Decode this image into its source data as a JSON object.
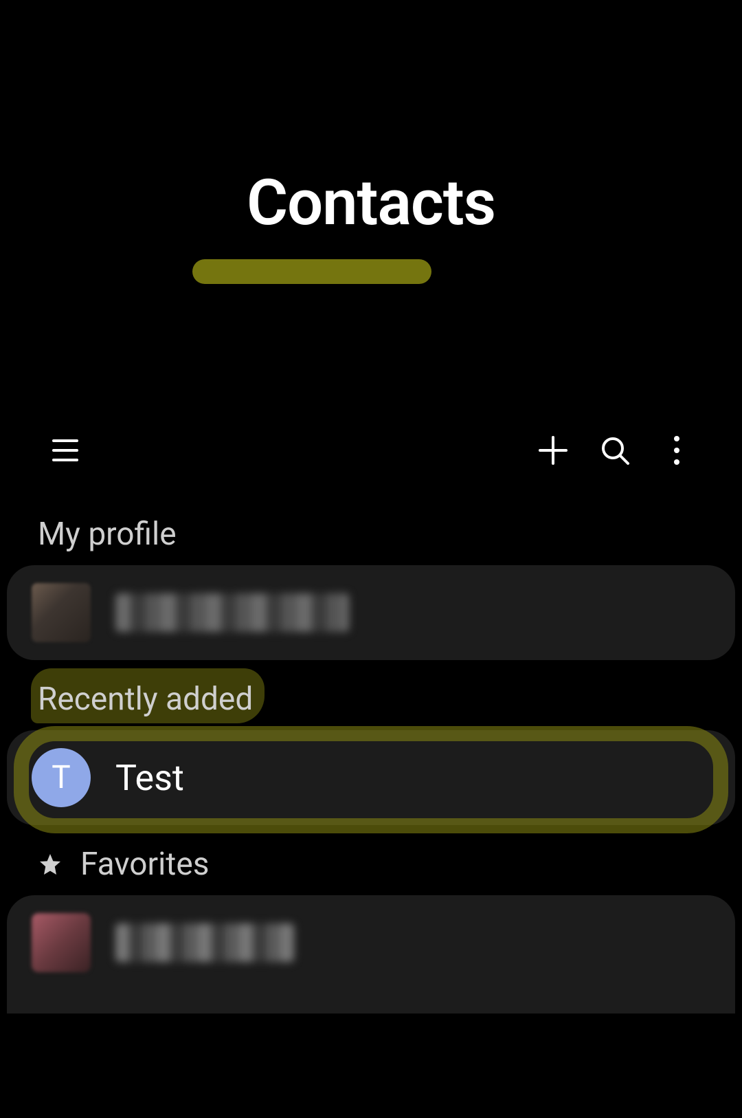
{
  "header": {
    "title": "Contacts"
  },
  "toolbar": {
    "menu_icon": "menu-icon",
    "add_icon": "plus-icon",
    "search_icon": "search-icon",
    "more_icon": "more-vertical-icon"
  },
  "sections": {
    "my_profile": {
      "label": "My profile",
      "items": [
        {
          "name": "[redacted]",
          "avatar_letter": ""
        }
      ]
    },
    "recently_added": {
      "label": "Recently added",
      "items": [
        {
          "name": "Test",
          "avatar_letter": "T",
          "avatar_color": "#8fa8e8"
        }
      ]
    },
    "favorites": {
      "label": "Favorites",
      "icon": "star-icon",
      "items": [
        {
          "name": "[redacted]",
          "avatar_letter": ""
        }
      ]
    }
  },
  "annotations": {
    "title_underlined": true,
    "recently_added_circled": true
  }
}
